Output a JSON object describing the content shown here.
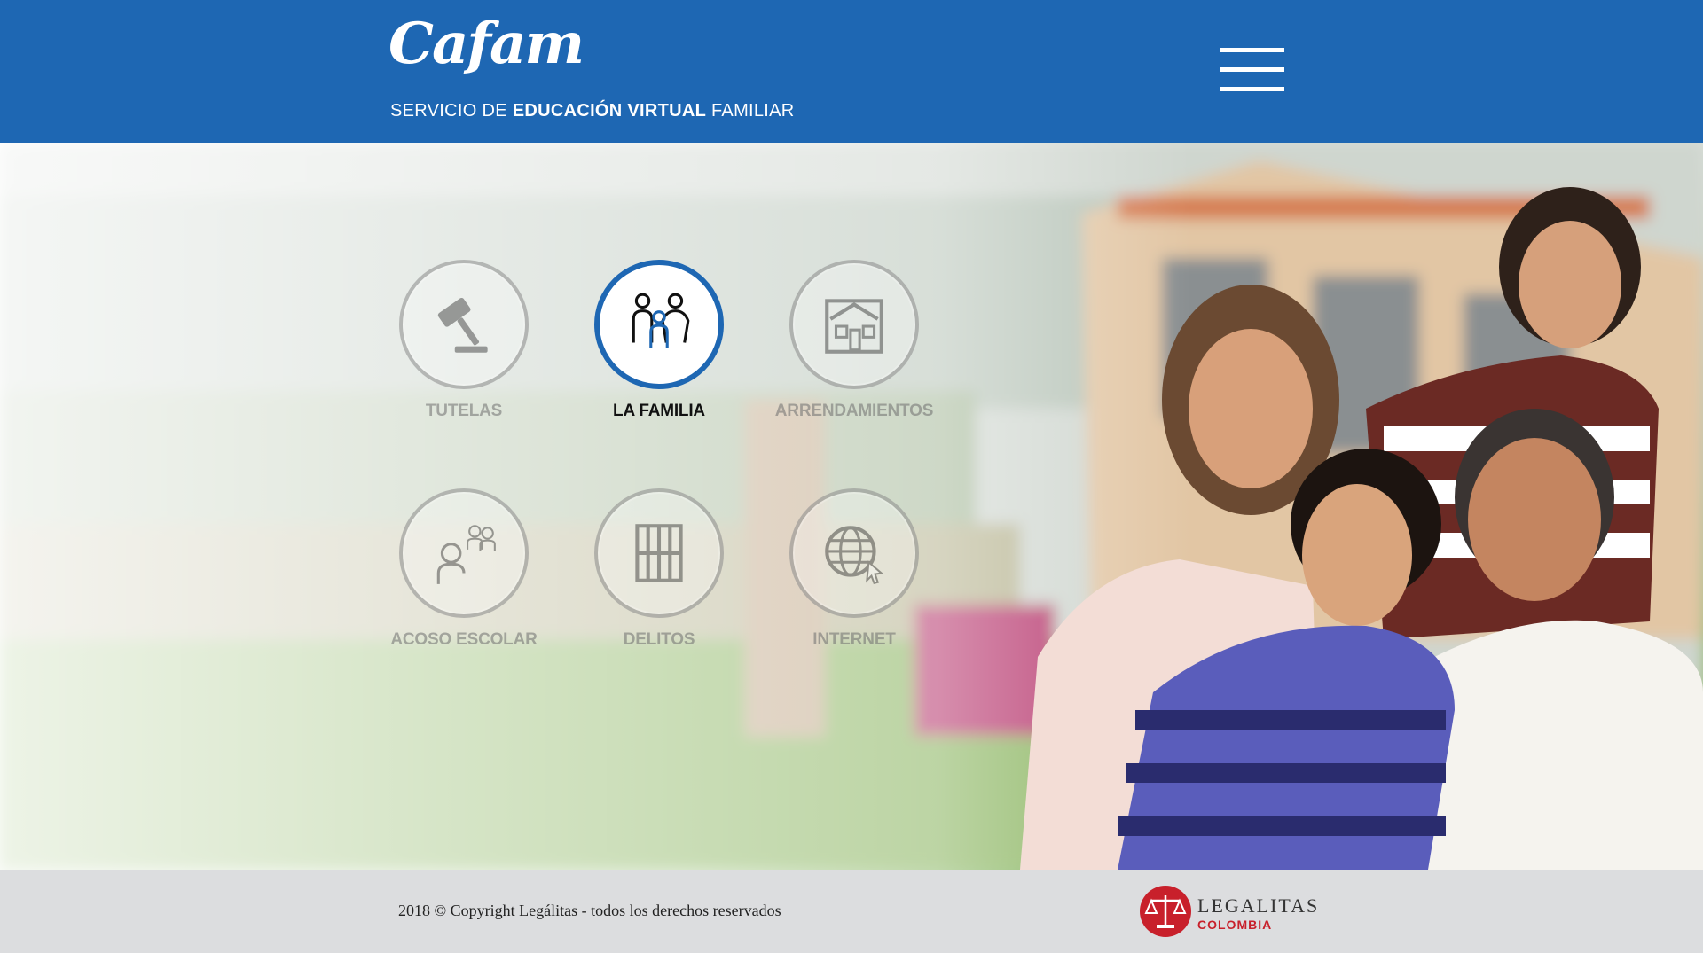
{
  "header": {
    "logo_text": "Cafam",
    "tagline_prefix": "SERVICIO DE ",
    "tagline_strong": "EDUCACIÓN VIRTUAL",
    "tagline_suffix": " FAMILIAR",
    "menu_icon": "hamburger-menu-icon"
  },
  "categories": [
    {
      "label": "TUTELAS",
      "icon": "gavel-icon",
      "active": false
    },
    {
      "label": "LA FAMILIA",
      "icon": "family-icon",
      "active": true
    },
    {
      "label": "ARRENDAMIENTOS",
      "icon": "house-icon",
      "active": false
    },
    {
      "label": "ACOSO ESCOLAR",
      "icon": "bullying-icon",
      "active": false
    },
    {
      "label": "DELITOS",
      "icon": "prison-bars-icon",
      "active": false
    },
    {
      "label": "INTERNET",
      "icon": "globe-cursor-icon",
      "active": false
    }
  ],
  "colors": {
    "brand_blue": "#1e67b3",
    "footer_bg": "#dcdddf",
    "legalitas_red": "#c8202b"
  },
  "footer": {
    "copyright": "2018 © Copyright Legálitas - todos los derechos reservados",
    "brand_name": "LEGALITAS",
    "brand_sub": "COLOMBIA",
    "brand_icon": "scales-of-justice-icon"
  }
}
